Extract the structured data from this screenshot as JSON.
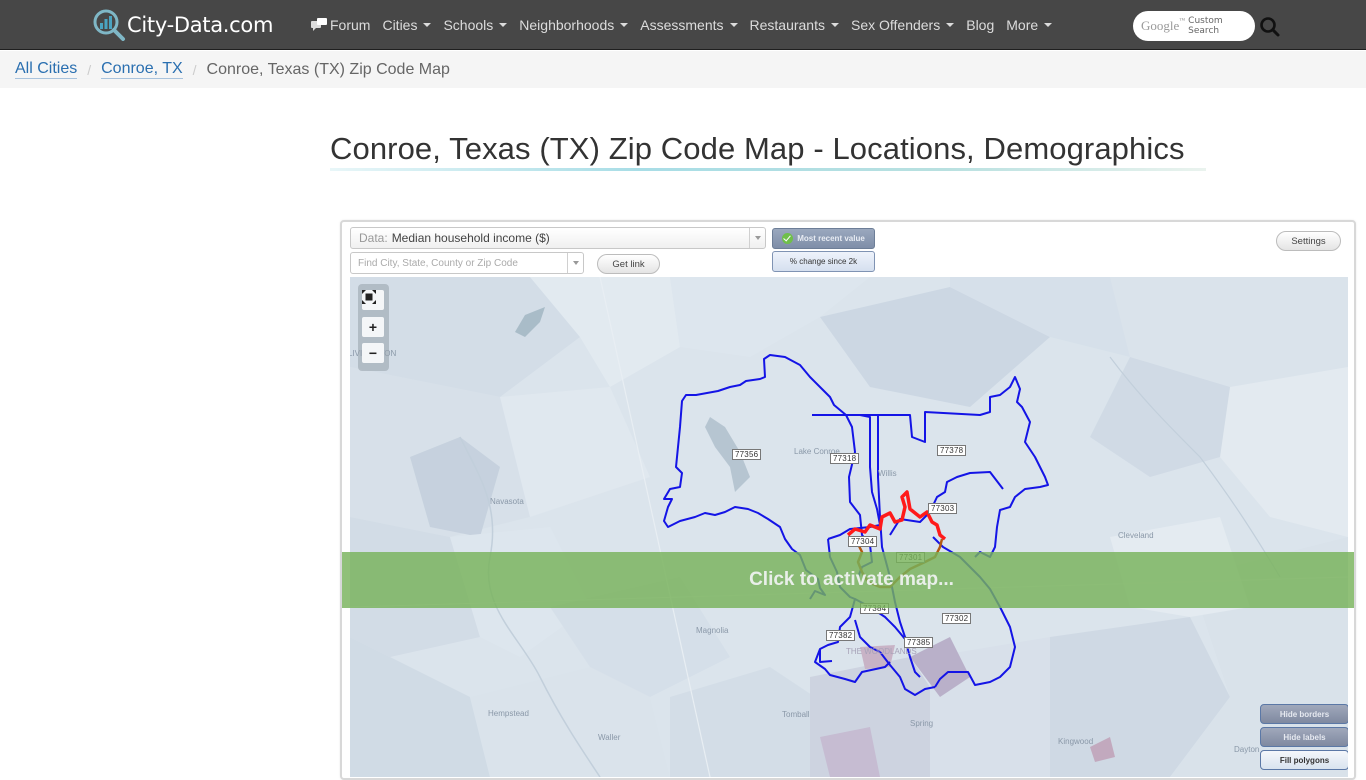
{
  "navbar": {
    "logo_text": "City-Data.com",
    "items": [
      {
        "label": "Forum",
        "icon": "forum-icon",
        "dropdown": false
      },
      {
        "label": "Cities",
        "dropdown": true
      },
      {
        "label": "Schools",
        "dropdown": true
      },
      {
        "label": "Neighborhoods",
        "dropdown": true
      },
      {
        "label": "Assessments",
        "dropdown": true
      },
      {
        "label": "Restaurants",
        "dropdown": true
      },
      {
        "label": "Sex Offenders",
        "dropdown": true
      },
      {
        "label": "Blog",
        "dropdown": false
      },
      {
        "label": "More",
        "dropdown": true
      }
    ],
    "search": {
      "google_label": "Google",
      "tm": "™",
      "custom_search_label": "Custom Search",
      "button_icon": "search-icon"
    }
  },
  "breadcrumb": {
    "items": [
      {
        "label": "All Cities",
        "link": true
      },
      {
        "label": "Conroe, TX",
        "link": true
      },
      {
        "label": "Conroe, Texas (TX) Zip Code Map",
        "link": false
      }
    ],
    "separator": "/"
  },
  "page": {
    "title": "Conroe, Texas (TX) Zip Code Map - Locations, Demographics"
  },
  "map": {
    "data_select_label": "Data:",
    "data_select_value": "Median household income ($)",
    "find_placeholder": "Find City, State, County or Zip Code",
    "get_link_label": "Get link",
    "most_recent_label": "Most recent value",
    "pct_change_label": "% change since 2k",
    "settings_label": "Settings",
    "zoom_controls": {
      "fit": "fit-extent-icon",
      "in": "+",
      "out": "−"
    },
    "activate_message": "Click to activate map...",
    "option_buttons": [
      {
        "label": "Hide borders",
        "active": true
      },
      {
        "label": "Hide labels",
        "active": true
      },
      {
        "label": "Fill polygons",
        "active": false
      }
    ],
    "place_labels": [
      "LIVINGSTON",
      "Navasota",
      "Cleveland",
      "Magnolia",
      "Hempstead",
      "Tomball",
      "Spring",
      "Waller",
      "Kingwood",
      "Dayton",
      "Lake Conroe",
      "Willis",
      "THE WOODLANDS"
    ],
    "zip_codes": [
      "77356",
      "77318",
      "77378",
      "77303",
      "77304",
      "77301",
      "77384",
      "77302",
      "77382",
      "77385"
    ],
    "colors": {
      "zip_border": "#1414e6",
      "city_border": "#ff1a1a",
      "overlay": "#78b25a",
      "base_map": "#dbe4ec"
    }
  }
}
